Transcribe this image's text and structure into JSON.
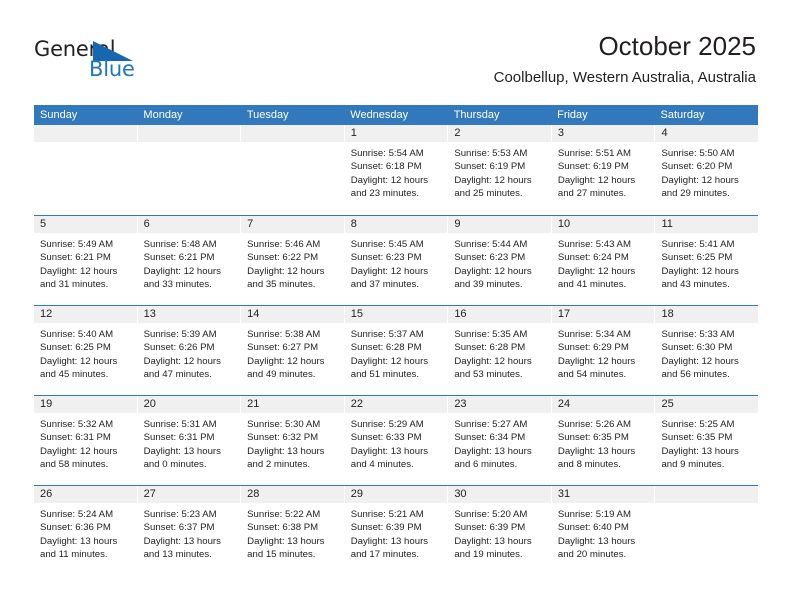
{
  "brand": {
    "name_top": "General",
    "name_bottom": "Blue",
    "accent_color": "#1667b0",
    "text_color": "#231f20"
  },
  "header": {
    "title": "October 2025",
    "subtitle": "Coolbellup, Western Australia, Australia"
  },
  "calendar": {
    "header_bg": "#3179bc",
    "day_header_bg": "#f0f0f0",
    "weekdays": [
      "Sunday",
      "Monday",
      "Tuesday",
      "Wednesday",
      "Thursday",
      "Friday",
      "Saturday"
    ],
    "weeks": [
      [
        {
          "day": "",
          "empty": true
        },
        {
          "day": "",
          "empty": true
        },
        {
          "day": "",
          "empty": true
        },
        {
          "day": "1",
          "sunrise": "Sunrise: 5:54 AM",
          "sunset": "Sunset: 6:18 PM",
          "daylight_line1": "Daylight: 12 hours",
          "daylight_line2": "and 23 minutes."
        },
        {
          "day": "2",
          "sunrise": "Sunrise: 5:53 AM",
          "sunset": "Sunset: 6:19 PM",
          "daylight_line1": "Daylight: 12 hours",
          "daylight_line2": "and 25 minutes."
        },
        {
          "day": "3",
          "sunrise": "Sunrise: 5:51 AM",
          "sunset": "Sunset: 6:19 PM",
          "daylight_line1": "Daylight: 12 hours",
          "daylight_line2": "and 27 minutes."
        },
        {
          "day": "4",
          "sunrise": "Sunrise: 5:50 AM",
          "sunset": "Sunset: 6:20 PM",
          "daylight_line1": "Daylight: 12 hours",
          "daylight_line2": "and 29 minutes."
        }
      ],
      [
        {
          "day": "5",
          "sunrise": "Sunrise: 5:49 AM",
          "sunset": "Sunset: 6:21 PM",
          "daylight_line1": "Daylight: 12 hours",
          "daylight_line2": "and 31 minutes."
        },
        {
          "day": "6",
          "sunrise": "Sunrise: 5:48 AM",
          "sunset": "Sunset: 6:21 PM",
          "daylight_line1": "Daylight: 12 hours",
          "daylight_line2": "and 33 minutes."
        },
        {
          "day": "7",
          "sunrise": "Sunrise: 5:46 AM",
          "sunset": "Sunset: 6:22 PM",
          "daylight_line1": "Daylight: 12 hours",
          "daylight_line2": "and 35 minutes."
        },
        {
          "day": "8",
          "sunrise": "Sunrise: 5:45 AM",
          "sunset": "Sunset: 6:23 PM",
          "daylight_line1": "Daylight: 12 hours",
          "daylight_line2": "and 37 minutes."
        },
        {
          "day": "9",
          "sunrise": "Sunrise: 5:44 AM",
          "sunset": "Sunset: 6:23 PM",
          "daylight_line1": "Daylight: 12 hours",
          "daylight_line2": "and 39 minutes."
        },
        {
          "day": "10",
          "sunrise": "Sunrise: 5:43 AM",
          "sunset": "Sunset: 6:24 PM",
          "daylight_line1": "Daylight: 12 hours",
          "daylight_line2": "and 41 minutes."
        },
        {
          "day": "11",
          "sunrise": "Sunrise: 5:41 AM",
          "sunset": "Sunset: 6:25 PM",
          "daylight_line1": "Daylight: 12 hours",
          "daylight_line2": "and 43 minutes."
        }
      ],
      [
        {
          "day": "12",
          "sunrise": "Sunrise: 5:40 AM",
          "sunset": "Sunset: 6:25 PM",
          "daylight_line1": "Daylight: 12 hours",
          "daylight_line2": "and 45 minutes."
        },
        {
          "day": "13",
          "sunrise": "Sunrise: 5:39 AM",
          "sunset": "Sunset: 6:26 PM",
          "daylight_line1": "Daylight: 12 hours",
          "daylight_line2": "and 47 minutes."
        },
        {
          "day": "14",
          "sunrise": "Sunrise: 5:38 AM",
          "sunset": "Sunset: 6:27 PM",
          "daylight_line1": "Daylight: 12 hours",
          "daylight_line2": "and 49 minutes."
        },
        {
          "day": "15",
          "sunrise": "Sunrise: 5:37 AM",
          "sunset": "Sunset: 6:28 PM",
          "daylight_line1": "Daylight: 12 hours",
          "daylight_line2": "and 51 minutes."
        },
        {
          "day": "16",
          "sunrise": "Sunrise: 5:35 AM",
          "sunset": "Sunset: 6:28 PM",
          "daylight_line1": "Daylight: 12 hours",
          "daylight_line2": "and 53 minutes."
        },
        {
          "day": "17",
          "sunrise": "Sunrise: 5:34 AM",
          "sunset": "Sunset: 6:29 PM",
          "daylight_line1": "Daylight: 12 hours",
          "daylight_line2": "and 54 minutes."
        },
        {
          "day": "18",
          "sunrise": "Sunrise: 5:33 AM",
          "sunset": "Sunset: 6:30 PM",
          "daylight_line1": "Daylight: 12 hours",
          "daylight_line2": "and 56 minutes."
        }
      ],
      [
        {
          "day": "19",
          "sunrise": "Sunrise: 5:32 AM",
          "sunset": "Sunset: 6:31 PM",
          "daylight_line1": "Daylight: 12 hours",
          "daylight_line2": "and 58 minutes."
        },
        {
          "day": "20",
          "sunrise": "Sunrise: 5:31 AM",
          "sunset": "Sunset: 6:31 PM",
          "daylight_line1": "Daylight: 13 hours",
          "daylight_line2": "and 0 minutes."
        },
        {
          "day": "21",
          "sunrise": "Sunrise: 5:30 AM",
          "sunset": "Sunset: 6:32 PM",
          "daylight_line1": "Daylight: 13 hours",
          "daylight_line2": "and 2 minutes."
        },
        {
          "day": "22",
          "sunrise": "Sunrise: 5:29 AM",
          "sunset": "Sunset: 6:33 PM",
          "daylight_line1": "Daylight: 13 hours",
          "daylight_line2": "and 4 minutes."
        },
        {
          "day": "23",
          "sunrise": "Sunrise: 5:27 AM",
          "sunset": "Sunset: 6:34 PM",
          "daylight_line1": "Daylight: 13 hours",
          "daylight_line2": "and 6 minutes."
        },
        {
          "day": "24",
          "sunrise": "Sunrise: 5:26 AM",
          "sunset": "Sunset: 6:35 PM",
          "daylight_line1": "Daylight: 13 hours",
          "daylight_line2": "and 8 minutes."
        },
        {
          "day": "25",
          "sunrise": "Sunrise: 5:25 AM",
          "sunset": "Sunset: 6:35 PM",
          "daylight_line1": "Daylight: 13 hours",
          "daylight_line2": "and 9 minutes."
        }
      ],
      [
        {
          "day": "26",
          "sunrise": "Sunrise: 5:24 AM",
          "sunset": "Sunset: 6:36 PM",
          "daylight_line1": "Daylight: 13 hours",
          "daylight_line2": "and 11 minutes."
        },
        {
          "day": "27",
          "sunrise": "Sunrise: 5:23 AM",
          "sunset": "Sunset: 6:37 PM",
          "daylight_line1": "Daylight: 13 hours",
          "daylight_line2": "and 13 minutes."
        },
        {
          "day": "28",
          "sunrise": "Sunrise: 5:22 AM",
          "sunset": "Sunset: 6:38 PM",
          "daylight_line1": "Daylight: 13 hours",
          "daylight_line2": "and 15 minutes."
        },
        {
          "day": "29",
          "sunrise": "Sunrise: 5:21 AM",
          "sunset": "Sunset: 6:39 PM",
          "daylight_line1": "Daylight: 13 hours",
          "daylight_line2": "and 17 minutes."
        },
        {
          "day": "30",
          "sunrise": "Sunrise: 5:20 AM",
          "sunset": "Sunset: 6:39 PM",
          "daylight_line1": "Daylight: 13 hours",
          "daylight_line2": "and 19 minutes."
        },
        {
          "day": "31",
          "sunrise": "Sunrise: 5:19 AM",
          "sunset": "Sunset: 6:40 PM",
          "daylight_line1": "Daylight: 13 hours",
          "daylight_line2": "and 20 minutes."
        },
        {
          "day": "",
          "empty": true
        }
      ]
    ]
  }
}
